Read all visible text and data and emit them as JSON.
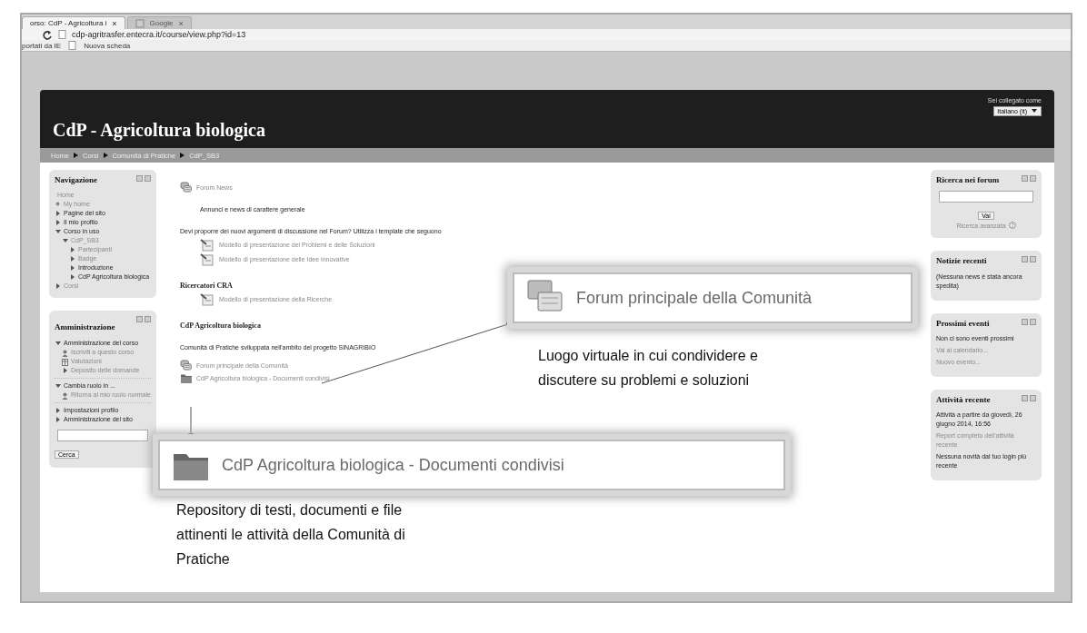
{
  "browser": {
    "tabs": [
      {
        "label": "orso: CdP - Agricoltura i",
        "selected": true,
        "close": "×"
      },
      {
        "label": "Google",
        "selected": false,
        "close": "×"
      }
    ],
    "url": "cdp-agritrasfer.entecra.it/course/view.php?id=13",
    "bookmarks": [
      "portati da IE",
      "Nuova scheda"
    ]
  },
  "header": {
    "title": "CdP - Agricoltura biologica",
    "login": "Sei collegato come",
    "language": "Italiano (it)"
  },
  "breadcrumb": [
    "Home",
    "Corsi",
    "Comunità di Pratiche",
    "CdP_SB3"
  ],
  "left_column": [
    {
      "kind": "tree",
      "title": "Navigazione",
      "items": [
        {
          "label": "Home",
          "kind": "plain",
          "link": true
        },
        {
          "label": "My home",
          "kind": "leaf",
          "link": true
        },
        {
          "label": "Pagine del sito",
          "kind": "branch",
          "expanded": false,
          "link": false
        },
        {
          "label": "Il mio profilo",
          "kind": "branch",
          "expanded": false,
          "link": false
        },
        {
          "label": "Corso in uso",
          "kind": "branch",
          "expanded": true,
          "link": false,
          "children": [
            {
              "label": "CdP_SB3",
              "kind": "branch",
              "expanded": true,
              "link": true,
              "children": [
                {
                  "label": "Partecipanti",
                  "kind": "branch",
                  "expanded": false,
                  "link": true
                },
                {
                  "label": "Badge",
                  "kind": "branch",
                  "expanded": false,
                  "link": true
                },
                {
                  "label": "Introduzione",
                  "kind": "branch",
                  "expanded": false,
                  "link": false
                },
                {
                  "label": "CdP Agricoltura biologica",
                  "kind": "branch",
                  "expanded": false,
                  "link": false
                }
              ]
            }
          ]
        },
        {
          "label": "Corsi",
          "kind": "branch",
          "expanded": false,
          "link": true
        }
      ]
    },
    {
      "kind": "tree",
      "title": "Amministrazione",
      "button": "Cerca",
      "items": [
        {
          "label": "Amministrazione del corso",
          "kind": "branch",
          "expanded": true,
          "link": false,
          "children": [
            {
              "label": "Iscriviti a questo corso",
              "kind": "person",
              "link": true
            },
            {
              "label": "Valutazioni",
              "kind": "grades",
              "link": true
            },
            {
              "label": "Deposito delle domande",
              "kind": "branch",
              "expanded": false,
              "link": true
            }
          ]
        },
        {
          "label": "Cambia ruolo in ...",
          "kind": "branch",
          "expanded": true,
          "link": false,
          "children": [
            {
              "label": "Ritorna al mio ruolo normale",
              "kind": "person",
              "link": true
            }
          ]
        },
        {
          "label": "Impostazioni profilo",
          "kind": "branch",
          "expanded": false,
          "link": false
        },
        {
          "label": "Amministrazione del sito",
          "kind": "branch",
          "expanded": false,
          "link": false
        }
      ]
    }
  ],
  "course": [
    {
      "kind": "forum",
      "label": "Forum News"
    },
    {
      "kind": "note",
      "label": "Annunci e news di carattere generale"
    },
    {
      "kind": "text",
      "label": "Devi proporre dei nuovi argomenti di discussione nel Forum? Utilizza i template che seguono"
    },
    {
      "kind": "template",
      "label": "Modello di presentazione dei Problemi e delle Soluzioni"
    },
    {
      "kind": "template",
      "label": "Modello di presentazione delle Idee innovative"
    },
    {
      "kind": "heading",
      "label": "Ricercatori CRA"
    },
    {
      "kind": "template",
      "label": "Modello di presentazione della Ricerche"
    },
    {
      "kind": "heading",
      "label": "CdP Agricoltura biologica"
    },
    {
      "kind": "text",
      "label": "Comunità di Pratiche sviluppata nell'ambito del progetto SINAGRIBIO"
    },
    {
      "kind": "forum",
      "label": "Forum principale della Comunità"
    },
    {
      "kind": "folder",
      "label": "CdP Agricoltura biologica - Documenti condivisi"
    }
  ],
  "right_column": [
    {
      "kind": "search",
      "title": "Ricerca nei forum",
      "button": "Vai",
      "link": "Ricerca avanzata"
    },
    {
      "kind": "text",
      "title": "Notizie recenti",
      "lines": [
        {
          "text": "(Nessuna news è stata ancora spedita)",
          "link": false
        }
      ]
    },
    {
      "kind": "text",
      "title": "Prossimi eventi",
      "lines": [
        {
          "text": "Non ci sono eventi prossimi",
          "link": false
        },
        {
          "text": "Vai al calendario...",
          "link": true
        },
        {
          "text": "Nuovo evento...",
          "link": true
        }
      ]
    },
    {
      "kind": "text",
      "title": "Attività recente",
      "lines": [
        {
          "text": "Attività a partire da giovedì, 26 giugno 2014, 16:56",
          "link": false
        },
        {
          "text": "Report completo dell'attività recente",
          "link": true
        },
        {
          "text": "Nessuna novità dal tuo login più recente",
          "link": false
        }
      ]
    }
  ],
  "callouts": [
    {
      "kind": "forum",
      "label": "Forum principale della Comunità",
      "caption": "Luogo virtuale in cui condividere e discutere su problemi e soluzioni"
    },
    {
      "kind": "folder",
      "label": "CdP Agricoltura biologica - Documenti condivisi",
      "caption": "Repository di testi, documenti e file attinenti le attività della Comunità di Pratiche"
    }
  ]
}
